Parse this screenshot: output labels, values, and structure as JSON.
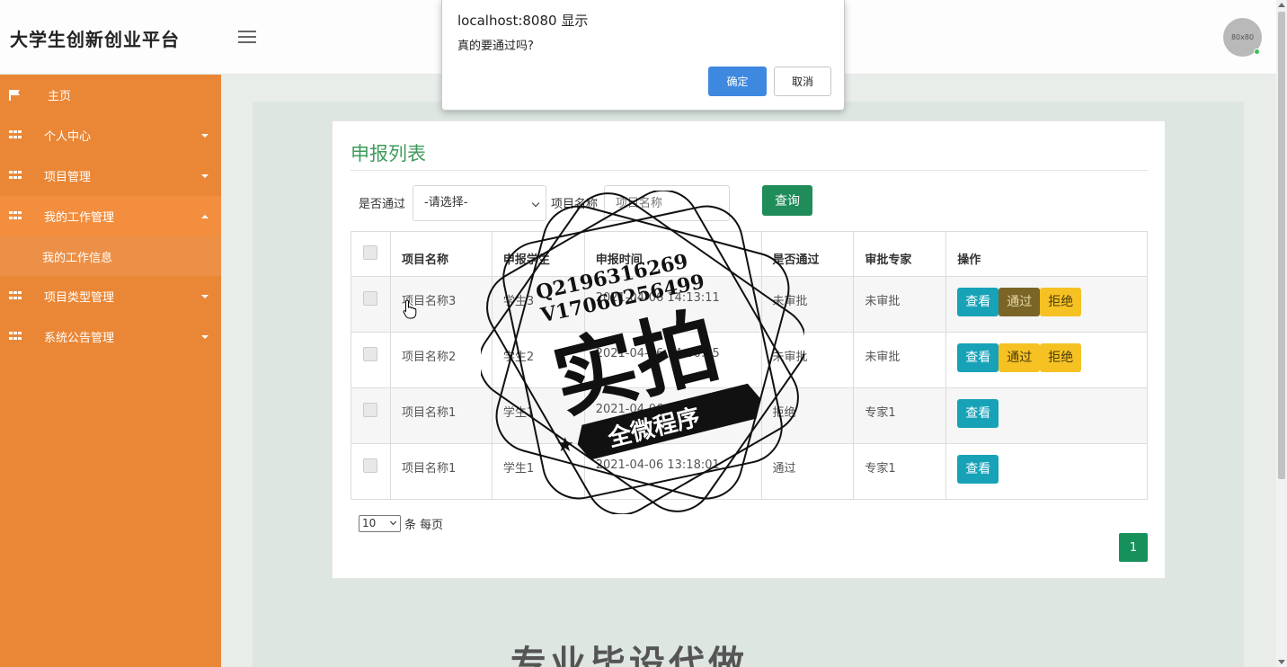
{
  "header": {
    "brand": "大学生创新创业平台",
    "avatar_text": "80x80"
  },
  "sidebar": {
    "items": [
      {
        "label": "主页",
        "icon": "flag-icon"
      },
      {
        "label": "个人中心",
        "icon": "grid-icon"
      },
      {
        "label": "项目管理",
        "icon": "grid-icon"
      },
      {
        "label": "我的工作管理",
        "icon": "grid-icon"
      },
      {
        "label": "项目类型管理",
        "icon": "grid-icon"
      },
      {
        "label": "系统公告管理",
        "icon": "grid-icon"
      }
    ],
    "sub_item": "我的工作信息"
  },
  "main": {
    "title": "申报列表",
    "filter_pass_label": "是否通过",
    "filter_pass_value": "-请选择-",
    "filter_name_label": "项目名称",
    "filter_name_placeholder": "项目名称",
    "query_button": "查询",
    "columns": [
      "项目名称",
      "申报学生",
      "申报时间",
      "是否通过",
      "审批专家",
      "操作"
    ],
    "rows": [
      {
        "name": "项目名称3",
        "student": "学生3",
        "time": "2021-04-06 14:13:11",
        "passed": "未审批",
        "expert": "未审批"
      },
      {
        "name": "项目名称2",
        "student": "学生2",
        "time": "2021-04-06 14:00:25",
        "passed": "未审批",
        "expert": "未审批"
      },
      {
        "name": "项目名称1",
        "student": "学生1",
        "time": "2021-04-06",
        "passed": "拒绝",
        "expert": "专家1"
      },
      {
        "name": "项目名称1",
        "student": "学生1",
        "time": "2021-04-06 13:18:01",
        "passed": "通过",
        "expert": "专家1"
      }
    ],
    "btn_view": "查看",
    "btn_pass": "通过",
    "btn_reject": "拒绝",
    "page_size": "10",
    "page_size_suffix": "条 每页",
    "current_page": "1"
  },
  "bottom_text": "专业毕设代做",
  "dialog": {
    "title": "localhost:8080 显示",
    "message": "真的要通过吗?",
    "ok": "确定",
    "cancel": "取消"
  },
  "watermark": {
    "line1": "Q2196316269",
    "line2": "V17060256499",
    "main": "实拍",
    "banner": "全微程序"
  },
  "colors": {
    "sidebar": "#ea8736",
    "accent_green": "#1f8c5a",
    "view_button": "#17a2b8",
    "warn_button": "#f6c223",
    "dialog_ok": "#3f88e0"
  }
}
